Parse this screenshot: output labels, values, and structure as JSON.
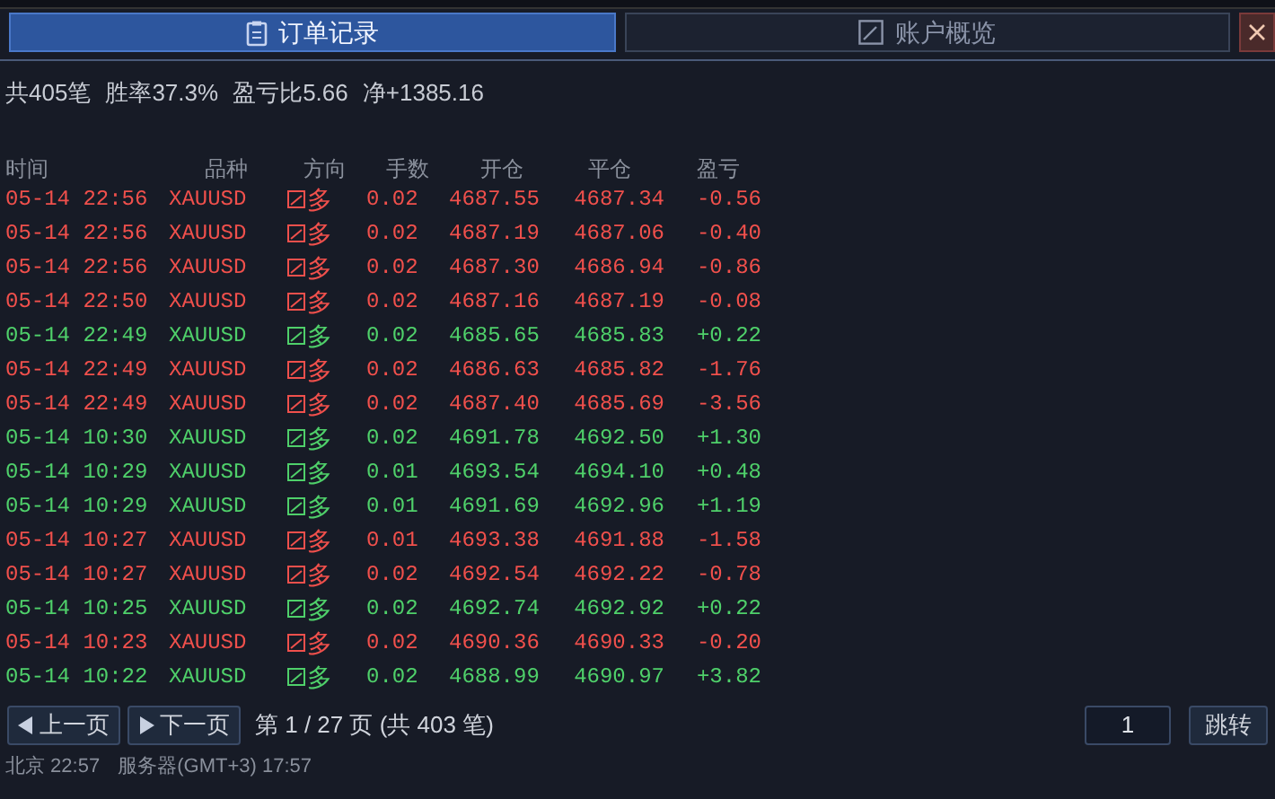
{
  "tabs": [
    {
      "label": "订单记录",
      "selected": true
    },
    {
      "label": "账户概览",
      "selected": false
    }
  ],
  "summary": {
    "count": "共405笔",
    "win_rate": "胜率37.3%",
    "pl_ratio": "盈亏比5.66",
    "net": "净+1385.16"
  },
  "table": {
    "columns": [
      "时间",
      "品种",
      "方向",
      "手数",
      "开仓",
      "平仓",
      "盈亏"
    ],
    "rows": [
      {
        "time": "05-14 22:56",
        "symbol": "XAUUSD",
        "side": "多",
        "lots": "0.02",
        "open": "4687.55",
        "close": "4687.34",
        "pnl": "-0.56",
        "kind": "loss"
      },
      {
        "time": "05-14 22:56",
        "symbol": "XAUUSD",
        "side": "多",
        "lots": "0.02",
        "open": "4687.19",
        "close": "4687.06",
        "pnl": "-0.40",
        "kind": "loss"
      },
      {
        "time": "05-14 22:56",
        "symbol": "XAUUSD",
        "side": "多",
        "lots": "0.02",
        "open": "4687.30",
        "close": "4686.94",
        "pnl": "-0.86",
        "kind": "loss"
      },
      {
        "time": "05-14 22:50",
        "symbol": "XAUUSD",
        "side": "多",
        "lots": "0.02",
        "open": "4687.16",
        "close": "4687.19",
        "pnl": "-0.08",
        "kind": "loss"
      },
      {
        "time": "05-14 22:49",
        "symbol": "XAUUSD",
        "side": "多",
        "lots": "0.02",
        "open": "4685.65",
        "close": "4685.83",
        "pnl": "+0.22",
        "kind": "win"
      },
      {
        "time": "05-14 22:49",
        "symbol": "XAUUSD",
        "side": "多",
        "lots": "0.02",
        "open": "4686.63",
        "close": "4685.82",
        "pnl": "-1.76",
        "kind": "loss"
      },
      {
        "time": "05-14 22:49",
        "symbol": "XAUUSD",
        "side": "多",
        "lots": "0.02",
        "open": "4687.40",
        "close": "4685.69",
        "pnl": "-3.56",
        "kind": "loss"
      },
      {
        "time": "05-14 10:30",
        "symbol": "XAUUSD",
        "side": "多",
        "lots": "0.02",
        "open": "4691.78",
        "close": "4692.50",
        "pnl": "+1.30",
        "kind": "win"
      },
      {
        "time": "05-14 10:29",
        "symbol": "XAUUSD",
        "side": "多",
        "lots": "0.01",
        "open": "4693.54",
        "close": "4694.10",
        "pnl": "+0.48",
        "kind": "win"
      },
      {
        "time": "05-14 10:29",
        "symbol": "XAUUSD",
        "side": "多",
        "lots": "0.01",
        "open": "4691.69",
        "close": "4692.96",
        "pnl": "+1.19",
        "kind": "win"
      },
      {
        "time": "05-14 10:27",
        "symbol": "XAUUSD",
        "side": "多",
        "lots": "0.01",
        "open": "4693.38",
        "close": "4691.88",
        "pnl": "-1.58",
        "kind": "loss"
      },
      {
        "time": "05-14 10:27",
        "symbol": "XAUUSD",
        "side": "多",
        "lots": "0.02",
        "open": "4692.54",
        "close": "4692.22",
        "pnl": "-0.78",
        "kind": "loss"
      },
      {
        "time": "05-14 10:25",
        "symbol": "XAUUSD",
        "side": "多",
        "lots": "0.02",
        "open": "4692.74",
        "close": "4692.92",
        "pnl": "+0.22",
        "kind": "win"
      },
      {
        "time": "05-14 10:23",
        "symbol": "XAUUSD",
        "side": "多",
        "lots": "0.02",
        "open": "4690.36",
        "close": "4690.33",
        "pnl": "-0.20",
        "kind": "loss"
      },
      {
        "time": "05-14 10:22",
        "symbol": "XAUUSD",
        "side": "多",
        "lots": "0.02",
        "open": "4688.99",
        "close": "4690.97",
        "pnl": "+3.82",
        "kind": "win"
      }
    ]
  },
  "pagination": {
    "prev": "上一页",
    "next": "下一页",
    "info": "第 1 / 27 页 (共 403 笔)",
    "page_input": "1",
    "jump": "跳转"
  },
  "status_bar": {
    "local_time": "北京 22:57",
    "server_time": "服务器(GMT+3) 17:57"
  }
}
